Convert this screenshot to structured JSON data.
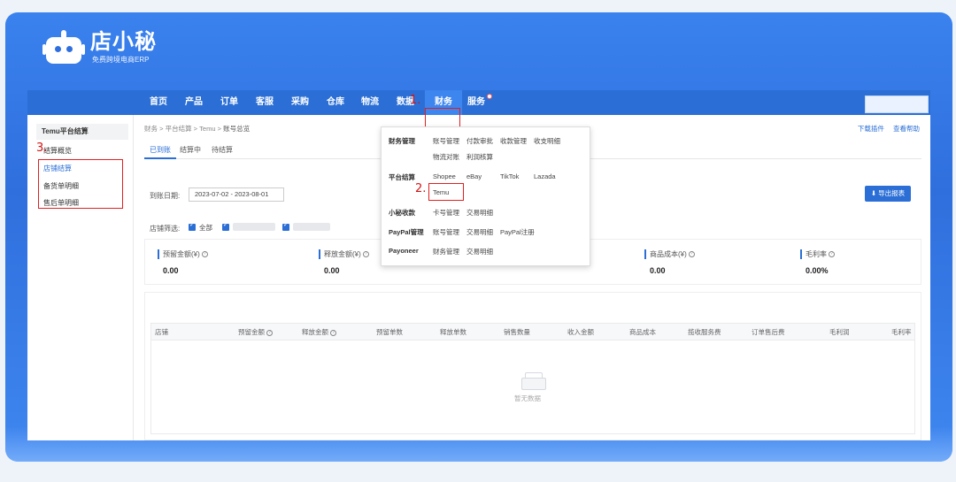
{
  "brand": {
    "name": "店小秘",
    "tagline": "免费跨境电商ERP"
  },
  "nav": {
    "items": [
      "首页",
      "产品",
      "订单",
      "客服",
      "采购",
      "仓库",
      "物流",
      "数据",
      "财务",
      "服务"
    ],
    "active": "财务"
  },
  "annotations": {
    "step1": "1.",
    "step2": "2.",
    "step3": "3.",
    "color": "#e02020"
  },
  "sidebar": {
    "title": "Temu平台结算",
    "overview": "结算概览",
    "items": [
      "店铺结算",
      "备货单明细",
      "售后单明细"
    ],
    "active_item": "店铺结算"
  },
  "breadcrumb": {
    "parts": [
      "财务",
      "平台结算",
      "Temu"
    ],
    "current": "账号总览",
    "separator": ">"
  },
  "help_links": [
    "下载插件",
    "查看帮助"
  ],
  "tabs": [
    "已到账",
    "结算中",
    "待结算"
  ],
  "filters": {
    "date_label": "到账日期:",
    "date_value": "2023-07-02 - 2023-08-01",
    "store_label": "店铺筛选:",
    "all_label": "全部"
  },
  "export_button": "⬇ 导出报表",
  "stats": [
    {
      "label": "预留金额(¥)",
      "value": "0.00"
    },
    {
      "label": "释放金额(¥)",
      "value": "0.00"
    },
    {
      "label": "商品成本(¥)",
      "value": "0.00"
    },
    {
      "label": "毛利率",
      "value": "0.00%"
    }
  ],
  "table": {
    "columns": [
      "店铺",
      "预留金额",
      "释放金额",
      "预留单数",
      "释放单数",
      "销售数量",
      "收入金额",
      "商品成本",
      "揽收服务费",
      "订单售后费",
      "毛利润",
      "毛利率"
    ],
    "empty_text": "暂无数据"
  },
  "finance_menu": {
    "groups": [
      {
        "title": "财务管理",
        "items": [
          "账号管理",
          "付款审批",
          "收款管理",
          "收支明细",
          "物流对账",
          "利润核算"
        ]
      },
      {
        "title": "平台结算",
        "items": [
          "Shopee",
          "eBay",
          "TikTok",
          "Lazada",
          "Temu"
        ]
      },
      {
        "title": "小秘收款",
        "items": [
          "卡号管理",
          "交易明细"
        ]
      },
      {
        "title": "PayPal管理",
        "items": [
          "账号管理",
          "交易明细",
          "PayPal注册"
        ]
      },
      {
        "title": "Payoneer",
        "items": [
          "财务管理",
          "交易明细"
        ]
      }
    ]
  },
  "colors": {
    "primary": "#2b6fd6",
    "frame": "#3a82ee",
    "alert": "#e02020"
  }
}
